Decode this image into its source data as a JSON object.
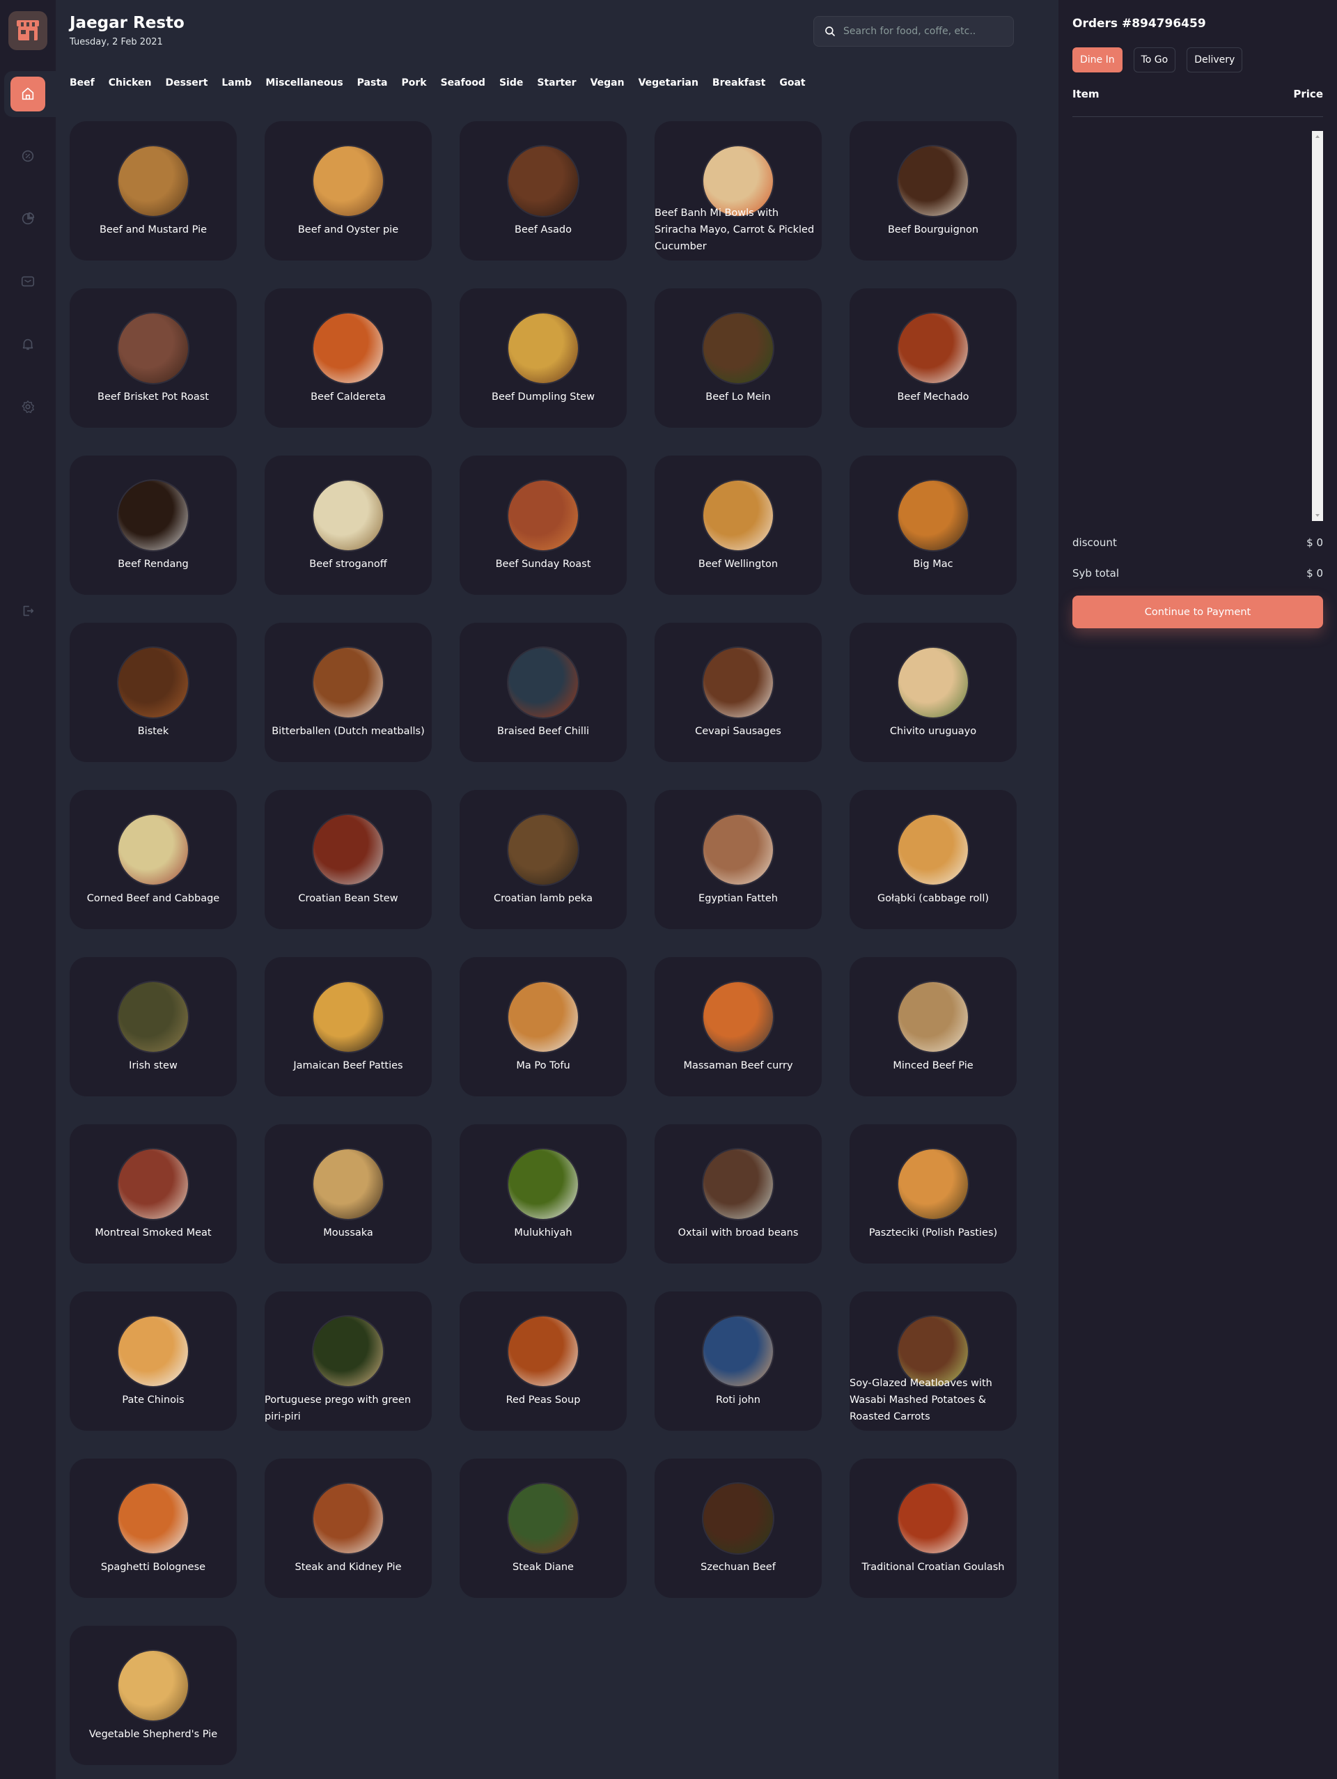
{
  "header": {
    "title": "Jaegar Resto",
    "date": "Tuesday, 2 Feb 2021",
    "search_placeholder": "Search for food, coffe, etc.."
  },
  "sidebar": {
    "items": [
      {
        "icon": "home-icon",
        "active": true
      },
      {
        "icon": "discount-icon",
        "active": false
      },
      {
        "icon": "dashboard-icon",
        "active": false
      },
      {
        "icon": "message-icon",
        "active": false
      },
      {
        "icon": "notification-icon",
        "active": false
      },
      {
        "icon": "settings-icon",
        "active": false
      },
      {
        "icon": "logout-icon",
        "active": false
      }
    ]
  },
  "categories": [
    "Beef",
    "Chicken",
    "Dessert",
    "Lamb",
    "Miscellaneous",
    "Pasta",
    "Pork",
    "Seafood",
    "Side",
    "Starter",
    "Vegan",
    "Vegetarian",
    "Breakfast",
    "Goat"
  ],
  "menu": [
    {
      "name": "Beef and Mustard Pie",
      "c1": "#b07a3a",
      "c2": "#5a3a1a"
    },
    {
      "name": "Beef and Oyster pie",
      "c1": "#d89a4a",
      "c2": "#7a4a22"
    },
    {
      "name": "Beef Asado",
      "c1": "#6a3a22",
      "c2": "#2a1a12"
    },
    {
      "name": "Beef Banh Mi Bowls with Sriracha Mayo, Carrot & Pickled Cucumber",
      "c1": "#e0c090",
      "c2": "#d45a2a"
    },
    {
      "name": "Beef Bourguignon",
      "c1": "#4a2a1a",
      "c2": "#e8e0d0"
    },
    {
      "name": "Beef Brisket Pot Roast",
      "c1": "#7a4a3a",
      "c2": "#3a2218"
    },
    {
      "name": "Beef Caldereta",
      "c1": "#c85a22",
      "c2": "#f0e8e0"
    },
    {
      "name": "Beef Dumpling Stew",
      "c1": "#d0a040",
      "c2": "#6a3a1a"
    },
    {
      "name": "Beef Lo Mein",
      "c1": "#5a3a22",
      "c2": "#2a4a1a"
    },
    {
      "name": "Beef Mechado",
      "c1": "#9a3a1a",
      "c2": "#e8e4e0"
    },
    {
      "name": "Beef Rendang",
      "c1": "#2a1a12",
      "c2": "#d0d0d0"
    },
    {
      "name": "Beef stroganoff",
      "c1": "#e0d4b0",
      "c2": "#8a6a3a"
    },
    {
      "name": "Beef Sunday Roast",
      "c1": "#a04a2a",
      "c2": "#d07a3a"
    },
    {
      "name": "Beef Wellington",
      "c1": "#c88a3a",
      "c2": "#f0e0d0"
    },
    {
      "name": "Big Mac",
      "c1": "#c8782a",
      "c2": "#3a2a1a"
    },
    {
      "name": "Bistek",
      "c1": "#5a3018",
      "c2": "#a05a2a"
    },
    {
      "name": "Bitterballen (Dutch meatballs)",
      "c1": "#8a4a22",
      "c2": "#e8e0d8"
    },
    {
      "name": "Braised Beef Chilli",
      "c1": "#2a3a4a",
      "c2": "#a03a1a"
    },
    {
      "name": "Cevapi Sausages",
      "c1": "#6a3a22",
      "c2": "#e8e0d8"
    },
    {
      "name": "Chivito uruguayo",
      "c1": "#e0c090",
      "c2": "#5a7a3a"
    },
    {
      "name": "Corned Beef and Cabbage",
      "c1": "#d8c890",
      "c2": "#a04a3a"
    },
    {
      "name": "Croatian Bean Stew",
      "c1": "#7a2a1a",
      "c2": "#c0c0c0"
    },
    {
      "name": "Croatian lamb peka",
      "c1": "#6a4a2a",
      "c2": "#2a2218"
    },
    {
      "name": "Egyptian Fatteh",
      "c1": "#a06a4a",
      "c2": "#e8d8c8"
    },
    {
      "name": "Gołąbki (cabbage roll)",
      "c1": "#d89a4a",
      "c2": "#f0e8d8"
    },
    {
      "name": "Irish stew",
      "c1": "#4a4a2a",
      "c2": "#8a7a4a"
    },
    {
      "name": "Jamaican Beef Patties",
      "c1": "#d8a040",
      "c2": "#2a2218"
    },
    {
      "name": "Ma Po Tofu",
      "c1": "#c8823a",
      "c2": "#e8e4e0"
    },
    {
      "name": "Massaman Beef curry",
      "c1": "#d06a2a",
      "c2": "#3a3a3a"
    },
    {
      "name": "Minced Beef Pie",
      "c1": "#b08a5a",
      "c2": "#e8dcc8"
    },
    {
      "name": "Montreal Smoked Meat",
      "c1": "#8a3a2a",
      "c2": "#e8d8c8"
    },
    {
      "name": "Moussaka",
      "c1": "#c8a060",
      "c2": "#3a2a1a"
    },
    {
      "name": "Mulukhiyah",
      "c1": "#4a6a1a",
      "c2": "#f0f0f0"
    },
    {
      "name": "Oxtail with broad beans",
      "c1": "#5a3a2a",
      "c2": "#c0c8c0"
    },
    {
      "name": "Paszteciki (Polish Pasties)",
      "c1": "#d89040",
      "c2": "#4a3a1a"
    },
    {
      "name": "Pate Chinois",
      "c1": "#e0a050",
      "c2": "#f0f0f0"
    },
    {
      "name": "Portuguese prego with green piri-piri",
      "c1": "#2a3a1a",
      "c2": "#d0b080"
    },
    {
      "name": "Red Peas Soup",
      "c1": "#a84a1a",
      "c2": "#f0e8e0"
    },
    {
      "name": "Roti john",
      "c1": "#2a4a7a",
      "c2": "#d0a070"
    },
    {
      "name": "Soy-Glazed Meatloaves with Wasabi Mashed Potatoes & Roasted Carrots",
      "c1": "#6a3a22",
      "c2": "#b0c060"
    },
    {
      "name": "Spaghetti Bolognese",
      "c1": "#d06a2a",
      "c2": "#e8e8e8"
    },
    {
      "name": "Steak and Kidney Pie",
      "c1": "#9a4a22",
      "c2": "#e8e0d8"
    },
    {
      "name": "Steak Diane",
      "c1": "#3a5a2a",
      "c2": "#7a3a22"
    },
    {
      "name": "Szechuan Beef",
      "c1": "#4a2a1a",
      "c2": "#2a3a1a"
    },
    {
      "name": "Traditional Croatian Goulash",
      "c1": "#a83a1a",
      "c2": "#f0e8e0"
    },
    {
      "name": "Vegetable Shepherd's Pie",
      "c1": "#e0b060",
      "c2": "#7a5a2a"
    }
  ],
  "orders": {
    "title": "Orders #894796459",
    "tabs": [
      "Dine In",
      "To Go",
      "Delivery"
    ],
    "active_tab": "Dine In",
    "col_item": "Item",
    "col_price": "Price",
    "discount_label": "discount",
    "discount_value": "$ 0",
    "subtotal_label": "Syb total",
    "subtotal_value": "$ 0",
    "pay_label": "Continue to Payment"
  },
  "colors": {
    "accent": "#ea7c69",
    "background": "#252836",
    "panel": "#1f1d2b"
  }
}
